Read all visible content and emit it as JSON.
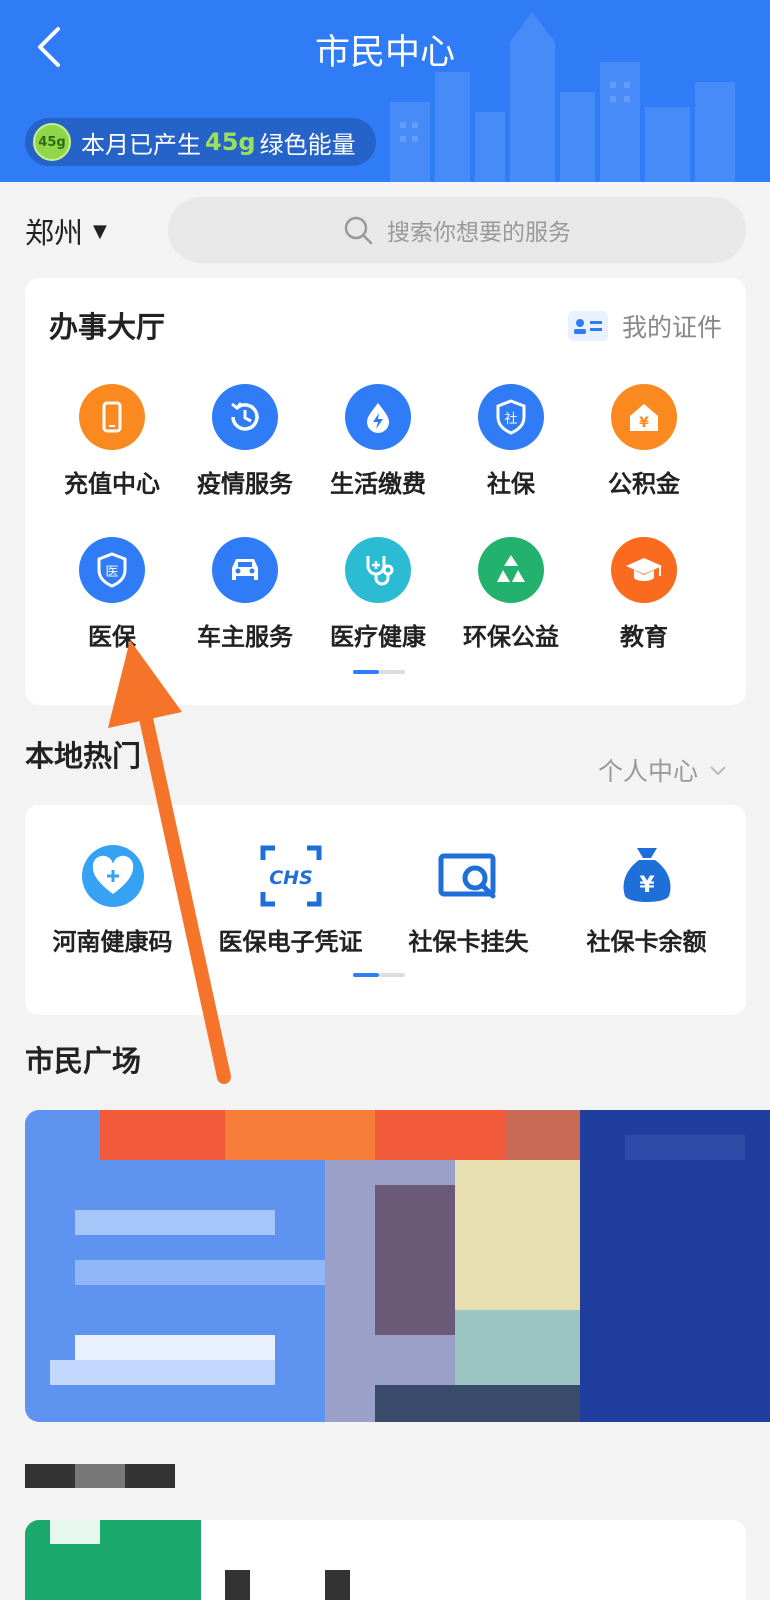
{
  "header": {
    "title": "市民中心",
    "energy_prefix": "本月已产生",
    "energy_value": "45g",
    "energy_suffix": "绿色能量",
    "badge": "45g"
  },
  "location": {
    "city": "郑州"
  },
  "search": {
    "placeholder": "搜索你想要的服务"
  },
  "hall": {
    "title": "办事大厅",
    "my_cert": "我的证件",
    "items": [
      {
        "label": "充值中心",
        "icon": "phone-icon",
        "color": "#fa8a1f"
      },
      {
        "label": "疫情服务",
        "icon": "clock-history-icon",
        "color": "#2f7cf6"
      },
      {
        "label": "生活缴费",
        "icon": "flame-drop-icon",
        "color": "#2f7cf6"
      },
      {
        "label": "社保",
        "icon": "shield-social-icon",
        "color": "#2f7cf6"
      },
      {
        "label": "公积金",
        "icon": "house-yuan-icon",
        "color": "#fa8a1f"
      },
      {
        "label": "医保",
        "icon": "shield-medical-icon",
        "color": "#2f7cf6"
      },
      {
        "label": "车主服务",
        "icon": "car-icon",
        "color": "#2f7cf6"
      },
      {
        "label": "医疗健康",
        "icon": "stethoscope-icon",
        "color": "#2bbcd4"
      },
      {
        "label": "环保公益",
        "icon": "recycle-icon",
        "color": "#23b26d"
      },
      {
        "label": "教育",
        "icon": "graduation-cap-icon",
        "color": "#fa6a1f"
      }
    ]
  },
  "local_hot": {
    "title": "本地热门",
    "personal_center": "个人中心",
    "items": [
      {
        "label": "河南健康码",
        "icon": "heart-plus-icon"
      },
      {
        "label": "医保电子凭证",
        "icon": "chs-icon"
      },
      {
        "label": "社保卡挂失",
        "icon": "card-search-icon"
      },
      {
        "label": "社保卡余额",
        "icon": "money-bag-icon"
      }
    ]
  },
  "plaza": {
    "title": "市民广场"
  },
  "colors": {
    "primary": "#2f7cf6",
    "orange": "#fa8a1f",
    "annotation_arrow": "#f5742a"
  }
}
